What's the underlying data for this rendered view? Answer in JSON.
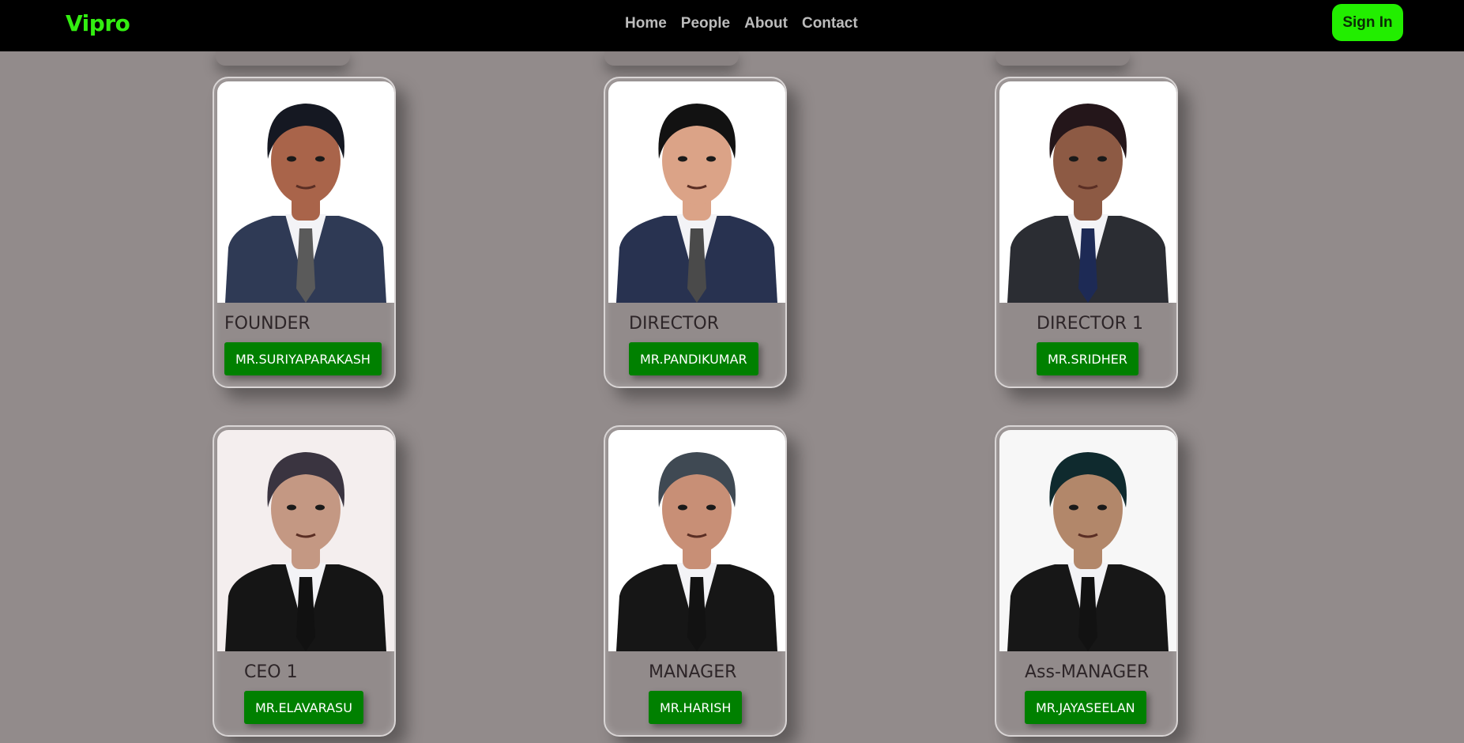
{
  "nav": {
    "brand": "Vipro",
    "links": [
      "Home",
      "People",
      "About",
      "Contact"
    ],
    "signin": "Sign In"
  },
  "people": [
    {
      "title": "FOUNDER",
      "name": "MR.SURIYAPARAKASH",
      "suit": "#2f3a55",
      "tie": "#5a5a5a",
      "skin": "#a9644a",
      "hair": "#151822",
      "bg": "#ffffff"
    },
    {
      "title": "DIRECTOR",
      "name": "MR.PANDIKUMAR",
      "suit": "#283250",
      "tie": "#4a4a4a",
      "skin": "#dba387",
      "hair": "#121212",
      "bg": "#ffffff"
    },
    {
      "title": "DIRECTOR 1",
      "name": "MR.SRIDHER",
      "suit": "#2b2d33",
      "tie": "#1d2a55",
      "skin": "#8d5a44",
      "hair": "#24161a",
      "bg": "#ffffff"
    },
    {
      "title": "CEO 1",
      "name": "MR.ELAVARASU",
      "suit": "#151515",
      "tie": "#111111",
      "skin": "#c49883",
      "hair": "#3a3440",
      "bg": "#f4eeee"
    },
    {
      "title": "MANAGER",
      "name": "MR.HARISH",
      "suit": "#161616",
      "tie": "#121212",
      "skin": "#c88f76",
      "hair": "#3f4953",
      "bg": "#ffffff"
    },
    {
      "title": "Ass-MANAGER",
      "name": "MR.JAYASEELAN",
      "suit": "#171717",
      "tie": "#121212",
      "skin": "#b2876a",
      "hair": "#0f2a2e",
      "bg": "#f7f7f7"
    }
  ]
}
